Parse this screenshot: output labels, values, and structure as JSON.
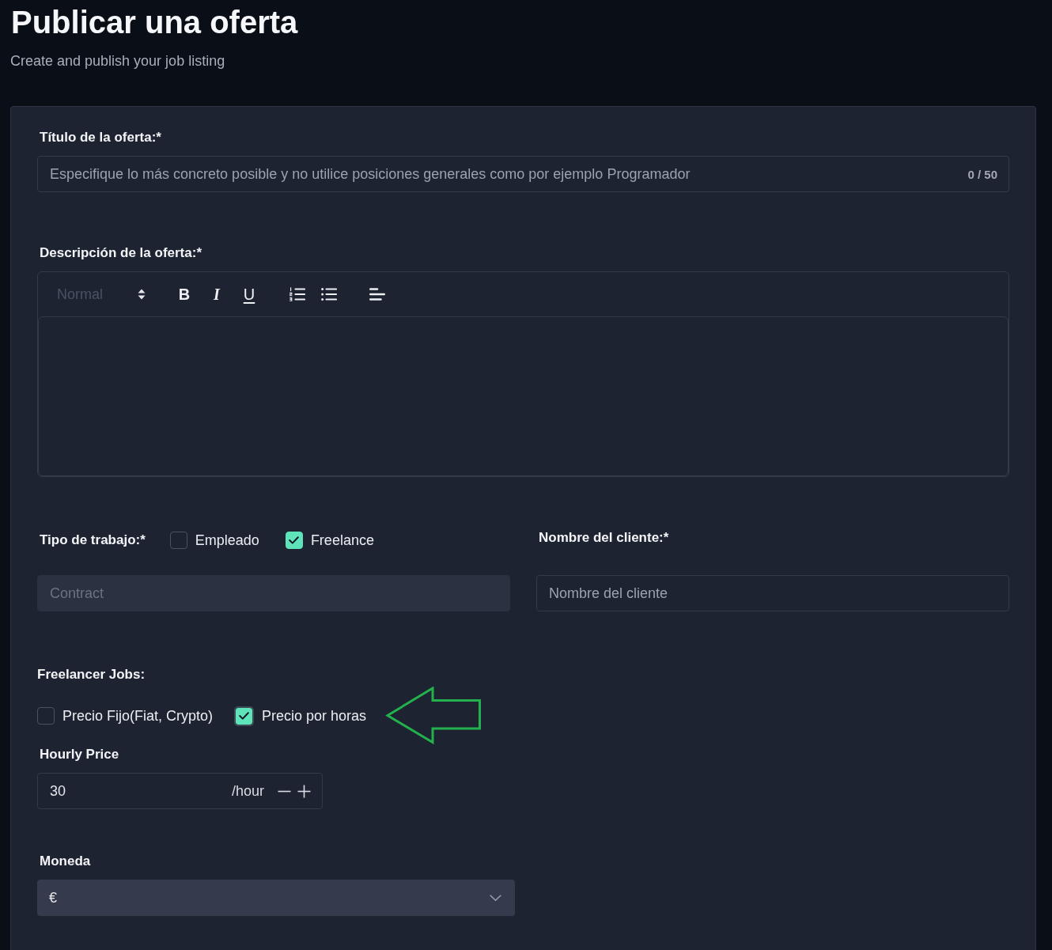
{
  "header": {
    "title": "Publicar una oferta",
    "subtitle": "Create and publish your job listing"
  },
  "title_field": {
    "label": "Título de la oferta:*",
    "placeholder": "Especifique lo más concreto posible y no utilice posiciones generales como por ejemplo Programador",
    "counter": "0 / 50"
  },
  "description": {
    "label": "Descripción de la oferta:*",
    "toolbar": {
      "format": "Normal",
      "tools": [
        {
          "kind": "bold",
          "label": "B"
        },
        {
          "kind": "italic",
          "label": "I"
        },
        {
          "kind": "underline",
          "label": "U"
        },
        {
          "kind": "ordered-list"
        },
        {
          "kind": "bullet-list"
        },
        {
          "kind": "align-left"
        }
      ]
    }
  },
  "job_type": {
    "label": "Tipo de trabajo:*",
    "options": [
      {
        "label": "Empleado",
        "checked": false
      },
      {
        "label": "Freelance",
        "checked": true
      }
    ],
    "contract": {
      "placeholder": "Contract",
      "disabled": true
    }
  },
  "client_name": {
    "label": "Nombre del cliente:*",
    "placeholder": "Nombre del cliente"
  },
  "freelancer_jobs": {
    "label": "Freelancer Jobs:",
    "options": [
      {
        "label": "Precio Fijo(Fiat, Crypto)",
        "checked": false,
        "focused": false
      },
      {
        "label": "Precio por horas",
        "checked": true,
        "focused": true
      }
    ]
  },
  "hourly_price": {
    "label": "Hourly Price",
    "value": "30",
    "unit": "/hour"
  },
  "currency": {
    "label": "Moneda",
    "value": "€"
  }
}
